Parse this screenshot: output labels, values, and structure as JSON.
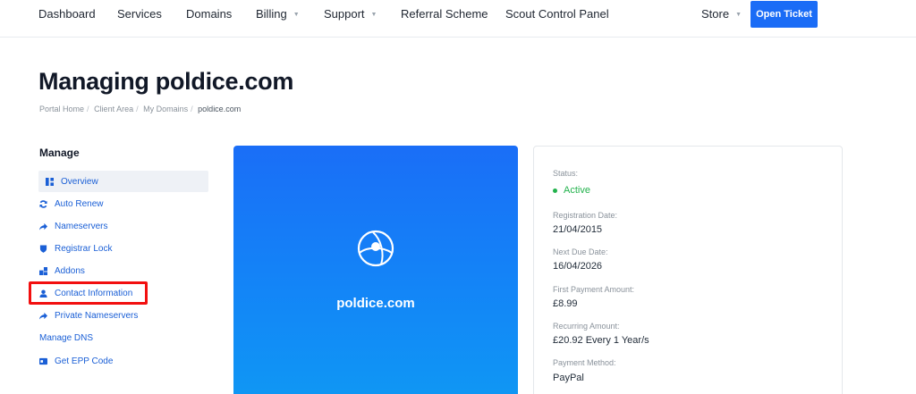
{
  "nav": {
    "items": [
      {
        "label": "Dashboard"
      },
      {
        "label": "Services"
      },
      {
        "label": "Domains"
      },
      {
        "label": "Billing"
      },
      {
        "label": "Support"
      },
      {
        "label": "Referral Scheme"
      },
      {
        "label": "Scout Control Panel"
      },
      {
        "label": "Store"
      }
    ],
    "open_ticket": "Open Ticket"
  },
  "page": {
    "title": "Managing poldice.com"
  },
  "breadcrumb": [
    "Portal Home",
    "Client Area",
    "My Domains",
    "poldice.com"
  ],
  "sidebar": {
    "heading": "Manage",
    "items": [
      {
        "label": "Overview",
        "icon": "dashboard-icon"
      },
      {
        "label": "Auto Renew",
        "icon": "sync-icon"
      },
      {
        "label": "Nameservers",
        "icon": "arrow-right-icon"
      },
      {
        "label": "Registrar Lock",
        "icon": "shield-icon"
      },
      {
        "label": "Addons",
        "icon": "cubes-icon"
      },
      {
        "label": "Contact Information",
        "icon": "user-icon"
      },
      {
        "label": "Private Nameservers",
        "icon": "arrow-right-icon"
      },
      {
        "label": "Manage DNS",
        "icon": ""
      },
      {
        "label": "Get EPP Code",
        "icon": "id-card-icon"
      }
    ]
  },
  "card": {
    "domain": "poldice.com"
  },
  "info": {
    "status_label": "Status:",
    "status_value": "Active",
    "reg_label": "Registration Date:",
    "reg_value": "21/04/2015",
    "due_label": "Next Due Date:",
    "due_value": "16/04/2026",
    "first_label": "First Payment Amount:",
    "first_value": "£8.99",
    "recurring_label": "Recurring Amount:",
    "recurring_value": "£20.92 Every 1 Year/s",
    "method_label": "Payment Method:",
    "method_value": "PayPal"
  },
  "colors": {
    "accent": "#1a6cf6",
    "status_active": "#22b24c",
    "highlight": "#f20f0f"
  }
}
